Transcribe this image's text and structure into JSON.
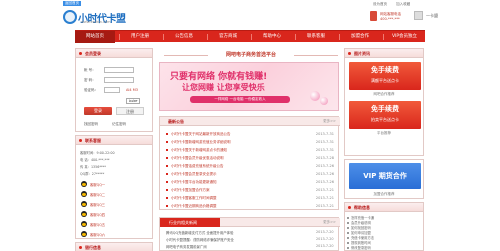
{
  "header": {
    "home_tag": "返回首页",
    "logo_text": "小时代卡盟",
    "logo_url": "www.xsdkm.com",
    "top_links": [
      "设为首页",
      "加入收藏"
    ],
    "phone_label": "网站客服电话",
    "phone_number": "400-***-***",
    "phone_link": "一卡盟"
  },
  "nav": {
    "items": [
      "网站首页",
      "用户注册",
      "公告信息",
      "官方商城",
      "帮助中心",
      "联系客服",
      "加盟合作",
      "VIP会员独立"
    ]
  },
  "login": {
    "title": "会员登录",
    "account_label": "帐 号：",
    "password_label": "密 码：",
    "code_label": "验证码：",
    "code_value": "AI4 M3",
    "captcha_text": "bdze",
    "login_button": "登录",
    "register_button": "注册",
    "forgot_link": "找回密码",
    "remember_link": "记住密码"
  },
  "service": {
    "title": "联系客服",
    "lines": [
      "客服时间：9:00-22:00",
      "电 话：400-***-***",
      "传 真：1356****",
      "QQ群：27*****"
    ],
    "qq_lines": [
      "客服QQ一",
      "客服QQ二",
      "客服QQ三",
      "客服QQ四",
      "客服QQ五",
      "客服QQ六"
    ]
  },
  "left_footer": {
    "title": "银行信息"
  },
  "center": {
    "platform_title": "网吧电子商务首选平台",
    "banner_line1": "只要有网络 你就有钱赚!",
    "banner_line2": "让您网赚 让您享受快乐",
    "banner_line3": "一样网络 一台电脑 一份稳定收入",
    "news_title": "最新公告",
    "news_more": "更多>>",
    "news": [
      {
        "title": "小时代卡盟关于网站最新开放商品公告",
        "date": "2013-7-31"
      },
      {
        "title": "小时代卡盟新增网游充值业务详细说明",
        "date": "2013-7-31"
      },
      {
        "title": "小时代卡盟关于新增网游点卡的通知",
        "date": "2013-7-31"
      },
      {
        "title": "小时代卡盟会员升级优惠活动说明",
        "date": "2013-7-28"
      },
      {
        "title": "小时代卡盟话费充值系统升级公告",
        "date": "2013-7-26"
      },
      {
        "title": "小时代卡盟会员登录安全提示",
        "date": "2013-7-26"
      },
      {
        "title": "小时代卡盟平台功能更新通知",
        "date": "2013-7-26"
      },
      {
        "title": "小时代卡盟加盟合作方案",
        "date": "2013-7-21"
      },
      {
        "title": "小时代卡盟客服工作时间调整",
        "date": "2013-7-21"
      },
      {
        "title": "小时代卡盟近期商品价格调整",
        "date": "2013-7-21"
      }
    ],
    "industry_title": "行业内相关新闻",
    "industry_more": "更多>>",
    "industry": [
      {
        "title": "腾讯QQ充值新增支付方式 全面提升用户体验",
        "date": "2013-7-20"
      },
      {
        "title": "小时代卡盟提醒：谨防网络诈骗保护账户安全",
        "date": "2013-7-20"
      },
      {
        "title": "网吧电子商务发展前景广阔",
        "date": "2013-7-20"
      }
    ]
  },
  "right": {
    "section_title": "图片资讯",
    "ad1_line1": "免手续费",
    "ad1_line2": "满额平台送点卡",
    "ad1_caption": "网吧合作推荐",
    "ad2_line1": "免手续费",
    "ad2_line2": "拍卖平台送点卡",
    "ad2_caption": "平台推荐",
    "ad3_line1": "VIP 期货合作",
    "ad3_caption": "加盟合作推荐",
    "help_title": "帮助信息",
    "help_items": [
      "怎样充值一卡通",
      "会员升级说明",
      "如何找回密码",
      "如何申请加盟",
      "充值卡使用方法",
      "提现到账时间",
      "修改登录密码",
      "联系客服方式"
    ]
  },
  "colors": {
    "primary": "#d9261c",
    "dark_red": "#a61a12",
    "logo_blue": "#1f6fc0",
    "banner_pink": "#e0306a",
    "ad_red": "#e8432d",
    "ad_blue": "#2a6ed6"
  }
}
